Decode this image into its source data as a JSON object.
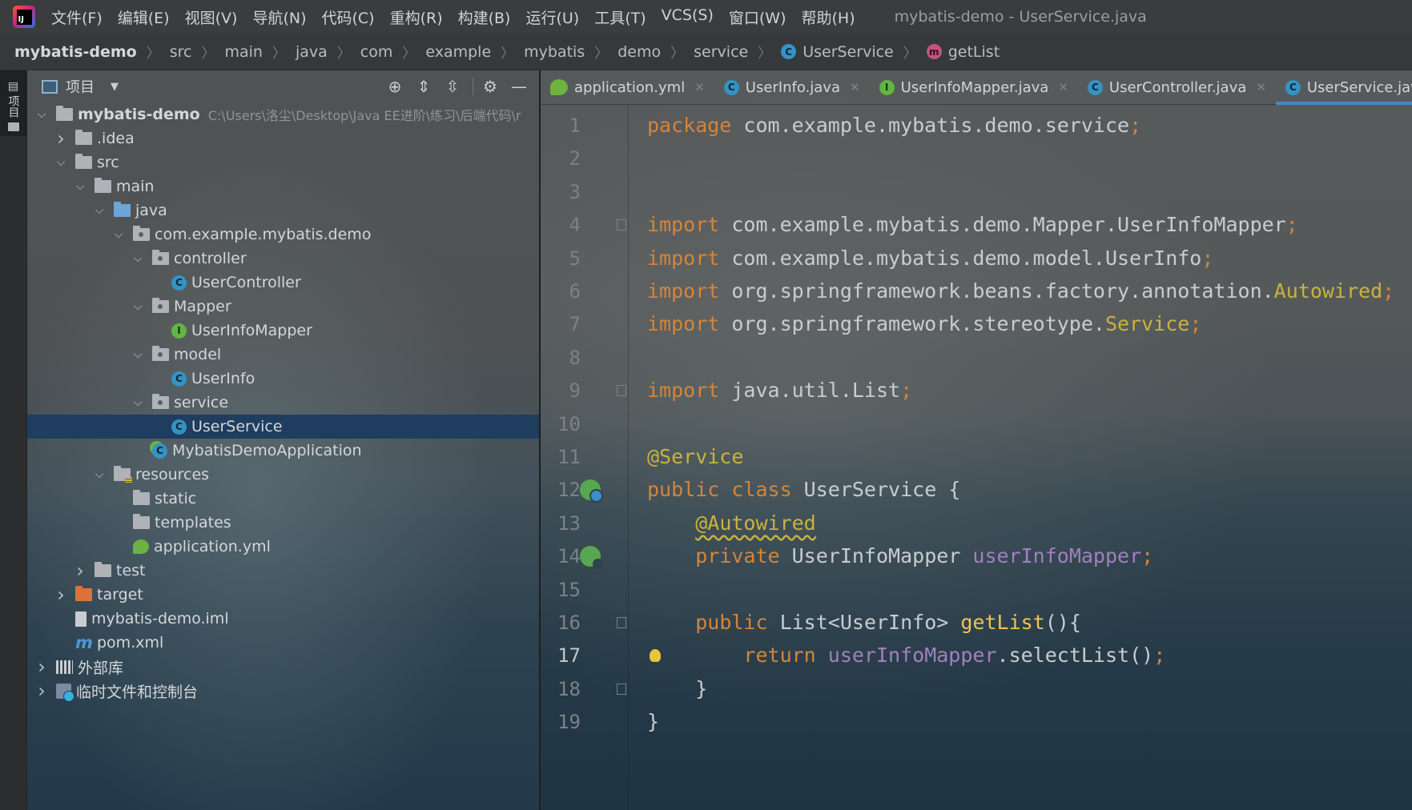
{
  "menubar": {
    "items": [
      "文件(F)",
      "编辑(E)",
      "视图(V)",
      "导航(N)",
      "代码(C)",
      "重构(R)",
      "构建(B)",
      "运行(U)",
      "工具(T)",
      "VCS(S)",
      "窗口(W)",
      "帮助(H)"
    ],
    "window_title": "mybatis-demo - UserService.java"
  },
  "breadcrumb": {
    "items": [
      "mybatis-demo",
      "src",
      "main",
      "java",
      "com",
      "example",
      "mybatis",
      "demo",
      "service",
      "UserService",
      "getList"
    ]
  },
  "left_strip": {
    "project_label": "项目"
  },
  "project_panel": {
    "title": "项目",
    "tree": [
      {
        "label": "mybatis-demo",
        "path": "C:\\Users\\洛尘\\Desktop\\Java EE进阶\\练习\\后端代码\\r",
        "icon": "module-folder-icon",
        "arrow": "expanded",
        "indent": 0,
        "bold": true
      },
      {
        "label": ".idea",
        "icon": "folder-icon",
        "arrow": "collapsed",
        "indent": 1
      },
      {
        "label": "src",
        "icon": "folder-icon",
        "arrow": "expanded",
        "indent": 1
      },
      {
        "label": "main",
        "icon": "folder-icon",
        "arrow": "expanded",
        "indent": 2
      },
      {
        "label": "java",
        "icon": "source-folder-icon",
        "arrow": "expanded",
        "indent": 3
      },
      {
        "label": "com.example.mybatis.demo",
        "icon": "package-icon",
        "arrow": "expanded",
        "indent": 4
      },
      {
        "label": "controller",
        "icon": "package-icon",
        "arrow": "expanded",
        "indent": 5
      },
      {
        "label": "UserController",
        "icon": "class-icon",
        "arrow": "none",
        "indent": 6
      },
      {
        "label": "Mapper",
        "icon": "package-icon",
        "arrow": "expanded",
        "indent": 5
      },
      {
        "label": "UserInfoMapper",
        "icon": "interface-icon",
        "arrow": "none",
        "indent": 6
      },
      {
        "label": "model",
        "icon": "package-icon",
        "arrow": "expanded",
        "indent": 5
      },
      {
        "label": "UserInfo",
        "icon": "class-icon",
        "arrow": "none",
        "indent": 6
      },
      {
        "label": "service",
        "icon": "package-icon",
        "arrow": "expanded",
        "indent": 5
      },
      {
        "label": "UserService",
        "icon": "class-icon",
        "arrow": "none",
        "indent": 6,
        "selected": true
      },
      {
        "label": "MybatisDemoApplication",
        "icon": "spring-boot-class-icon",
        "arrow": "none",
        "indent": 5
      },
      {
        "label": "resources",
        "icon": "resources-folder-icon",
        "arrow": "expanded",
        "indent": 3
      },
      {
        "label": "static",
        "icon": "folder-icon",
        "arrow": "none",
        "indent": 4
      },
      {
        "label": "templates",
        "icon": "folder-icon",
        "arrow": "none",
        "indent": 4
      },
      {
        "label": "application.yml",
        "icon": "yaml-file-icon",
        "arrow": "none",
        "indent": 4
      },
      {
        "label": "test",
        "icon": "folder-icon",
        "arrow": "collapsed",
        "indent": 2
      },
      {
        "label": "target",
        "icon": "excluded-folder-icon",
        "arrow": "collapsed",
        "indent": 1
      },
      {
        "label": "mybatis-demo.iml",
        "icon": "iml-file-icon",
        "arrow": "none",
        "indent": 1
      },
      {
        "label": "pom.xml",
        "icon": "maven-icon",
        "arrow": "none",
        "indent": 1
      },
      {
        "label": "外部库",
        "icon": "libraries-icon",
        "arrow": "collapsed",
        "indent": 0
      },
      {
        "label": "临时文件和控制台",
        "icon": "scratches-icon",
        "arrow": "collapsed",
        "indent": 0
      }
    ]
  },
  "editor": {
    "tabs": [
      {
        "label": "application.yml",
        "icon": "yaml-file-icon",
        "active": false
      },
      {
        "label": "UserInfo.java",
        "icon": "class-icon",
        "active": false
      },
      {
        "label": "UserInfoMapper.java",
        "icon": "interface-icon",
        "active": false
      },
      {
        "label": "UserController.java",
        "icon": "class-icon",
        "active": false
      },
      {
        "label": "UserService.java",
        "icon": "class-icon",
        "active": true
      }
    ],
    "current_line": 17,
    "lines": [
      [
        {
          "t": "package",
          "c": "kw"
        },
        {
          "t": " com.example.mybatis.demo.service"
        },
        {
          "t": ";",
          "c": "semi"
        }
      ],
      [],
      [],
      [
        {
          "t": "import",
          "c": "kw"
        },
        {
          "t": " com.example.mybatis.demo.Mapper.UserInfoMapper"
        },
        {
          "t": ";",
          "c": "semi"
        }
      ],
      [
        {
          "t": "import",
          "c": "kw"
        },
        {
          "t": " com.example.mybatis.demo.model.UserInfo"
        },
        {
          "t": ";",
          "c": "semi"
        }
      ],
      [
        {
          "t": "import",
          "c": "kw"
        },
        {
          "t": " org.springframework.beans.factory.annotation."
        },
        {
          "t": "Autowired",
          "c": "svc"
        },
        {
          "t": ";",
          "c": "semi"
        }
      ],
      [
        {
          "t": "import",
          "c": "kw"
        },
        {
          "t": " org.springframework.stereotype."
        },
        {
          "t": "Service",
          "c": "svc"
        },
        {
          "t": ";",
          "c": "semi"
        }
      ],
      [],
      [
        {
          "t": "import",
          "c": "kw"
        },
        {
          "t": " java.util.List"
        },
        {
          "t": ";",
          "c": "semi"
        }
      ],
      [],
      [
        {
          "t": "@Service",
          "c": "ann"
        }
      ],
      [
        {
          "t": "public class",
          "c": "kw"
        },
        {
          "t": " UserService {"
        }
      ],
      [
        {
          "t": "    "
        },
        {
          "t": "@Autowired",
          "c": "ann-wavy"
        }
      ],
      [
        {
          "t": "    "
        },
        {
          "t": "private",
          "c": "kw"
        },
        {
          "t": " UserInfoMapper "
        },
        {
          "t": "userInfoMapper",
          "c": "field"
        },
        {
          "t": ";",
          "c": "semi"
        }
      ],
      [],
      [
        {
          "t": "    "
        },
        {
          "t": "public",
          "c": "kw"
        },
        {
          "t": " List<UserInfo> "
        },
        {
          "t": "getList",
          "c": "method"
        },
        {
          "t": "(){"
        }
      ],
      [
        {
          "t": "        "
        },
        {
          "t": "return",
          "c": "kw"
        },
        {
          "t": " "
        },
        {
          "t": "userInfoMapper",
          "c": "field"
        },
        {
          "t": ".selectList()"
        },
        {
          "t": ";",
          "c": "semi"
        }
      ],
      [
        {
          "t": "    }"
        }
      ],
      [
        {
          "t": "}"
        }
      ]
    ],
    "gutter_markers": {
      "12": "spring-bean-icon",
      "14": "autowired-bean-icon"
    },
    "fold_markers": [
      4,
      9,
      16,
      18
    ],
    "intention_bulb_line": 17
  }
}
